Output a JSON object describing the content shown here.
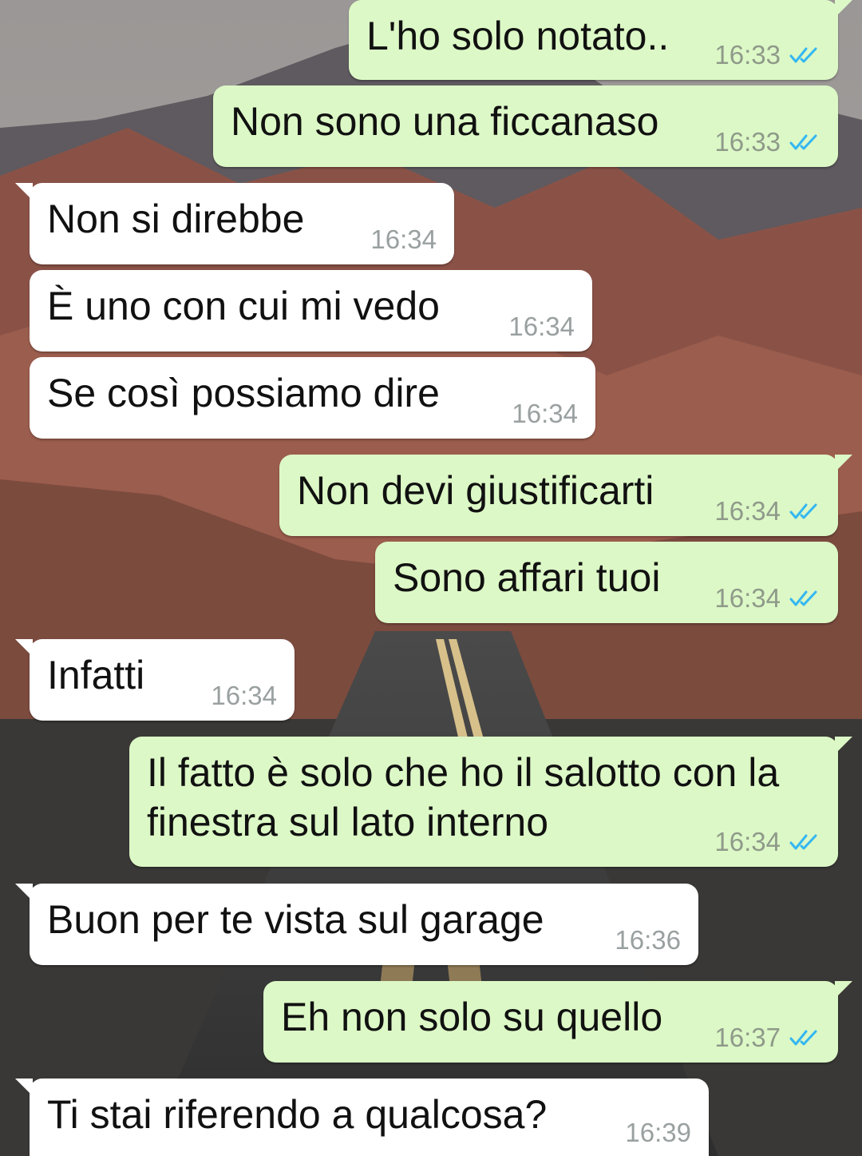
{
  "theme": {
    "outgoing_bg": "#dcf8c6",
    "incoming_bg": "#ffffff",
    "read_tick_color": "#34b7f1"
  },
  "messages": [
    {
      "direction": "outgoing",
      "text": "L'ho solo notato..",
      "time": "16:33",
      "status": "read"
    },
    {
      "direction": "outgoing",
      "text": "Non sono una ficcanaso",
      "time": "16:33",
      "status": "read"
    },
    {
      "direction": "incoming",
      "text": "Non si direbbe",
      "time": "16:34"
    },
    {
      "direction": "incoming",
      "text": "È uno con cui mi vedo",
      "time": "16:34"
    },
    {
      "direction": "incoming",
      "text": "Se così possiamo dire",
      "time": "16:34"
    },
    {
      "direction": "outgoing",
      "text": "Non devi giustificarti",
      "time": "16:34",
      "status": "read"
    },
    {
      "direction": "outgoing",
      "text": "Sono affari tuoi",
      "time": "16:34",
      "status": "read"
    },
    {
      "direction": "incoming",
      "text": "Infatti",
      "time": "16:34"
    },
    {
      "direction": "outgoing",
      "text": "Il fatto è solo che ho il salotto con la finestra sul lato interno",
      "time": "16:34",
      "status": "read"
    },
    {
      "direction": "incoming",
      "text": "Buon per te vista sul garage",
      "time": "16:36"
    },
    {
      "direction": "outgoing",
      "text": "Eh non solo su quello",
      "time": "16:37",
      "status": "read"
    },
    {
      "direction": "incoming",
      "text": "Ti stai riferendo a qualcosa?",
      "time": "16:39"
    }
  ]
}
